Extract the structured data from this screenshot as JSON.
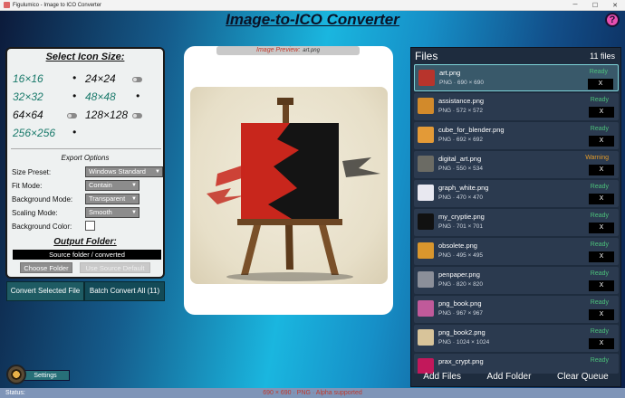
{
  "window": {
    "title": "Figulumico - Image to ICO Converter"
  },
  "app": {
    "title": "Image-to-ICO Converter",
    "help_label": "?"
  },
  "icon_sizes": {
    "title": "Select Icon Size:",
    "rows": [
      [
        {
          "label": "16×16",
          "enabled": true
        },
        {
          "label": "24×24",
          "enabled": false
        }
      ],
      [
        {
          "label": "32×32",
          "enabled": true
        },
        {
          "label": "48×48",
          "enabled": true
        }
      ],
      [
        {
          "label": "64×64",
          "enabled": false
        },
        {
          "label": "128×128",
          "enabled": false
        }
      ],
      [
        {
          "label": "256×256",
          "enabled": true
        }
      ]
    ],
    "dot": "•"
  },
  "export": {
    "title": "Export Options",
    "size_preset": {
      "label": "Size Preset:",
      "value": "Windows Standard"
    },
    "fit_mode": {
      "label": "Fit Mode:",
      "value": "Contain"
    },
    "background_mode": {
      "label": "Background Mode:",
      "value": "Transparent"
    },
    "scaling_mode": {
      "label": "Scaling Mode:",
      "value": "Smooth"
    },
    "background_color": {
      "label": "Background Color:"
    }
  },
  "output": {
    "title": "Output Folder:",
    "path": "Source folder / converted",
    "choose_label": "Choose Folder",
    "use_source_label": "Use Source Default"
  },
  "actions": {
    "convert_selected": "Convert Selected File",
    "batch_convert": "Batch Convert All (11)"
  },
  "preview": {
    "label": "Image Preview:",
    "filename": "art.png"
  },
  "files": {
    "title": "Files",
    "count": "11 files",
    "remove_label": "X",
    "items": [
      {
        "name": "art.png",
        "meta": "PNG · 690 × 690",
        "status": "Ready",
        "selected": true,
        "thumb": "#b8342c"
      },
      {
        "name": "assistance.png",
        "meta": "PNG · 572 × 572",
        "status": "Ready",
        "thumb": "#d28a2b"
      },
      {
        "name": "cube_for_blender.png",
        "meta": "PNG · 692 × 692",
        "status": "Ready",
        "thumb": "#e39a37"
      },
      {
        "name": "digital_art.png",
        "meta": "PNG · 550 × 534",
        "status": "Warning",
        "thumb": "#6b6b64"
      },
      {
        "name": "graph_white.png",
        "meta": "PNG · 470 × 470",
        "status": "Ready",
        "thumb": "#e8e8f0"
      },
      {
        "name": "my_cryptie.png",
        "meta": "PNG · 701 × 701",
        "status": "Ready",
        "thumb": "#111111"
      },
      {
        "name": "obsolete.png",
        "meta": "PNG · 495 × 495",
        "status": "Ready",
        "thumb": "#d9962d"
      },
      {
        "name": "penpaper.png",
        "meta": "PNG · 820 × 820",
        "status": "Ready",
        "thumb": "#8b8f99"
      },
      {
        "name": "png_book.png",
        "meta": "PNG · 967 × 967",
        "status": "Ready",
        "thumb": "#c05a9a"
      },
      {
        "name": "png_book2.png",
        "meta": "PNG · 1024 × 1024",
        "status": "Ready",
        "thumb": "#d8c49a"
      },
      {
        "name": "prax_crypt.png",
        "meta": "",
        "status": "Ready",
        "thumb": "#c2185b"
      }
    ],
    "add_files": "Add Files",
    "add_folder": "Add Folder",
    "clear_queue": "Clear Queue"
  },
  "settings": {
    "label": "Settings"
  },
  "status": {
    "label": "Status:",
    "text": "690 × 690 · PNG · Alpha supported"
  }
}
